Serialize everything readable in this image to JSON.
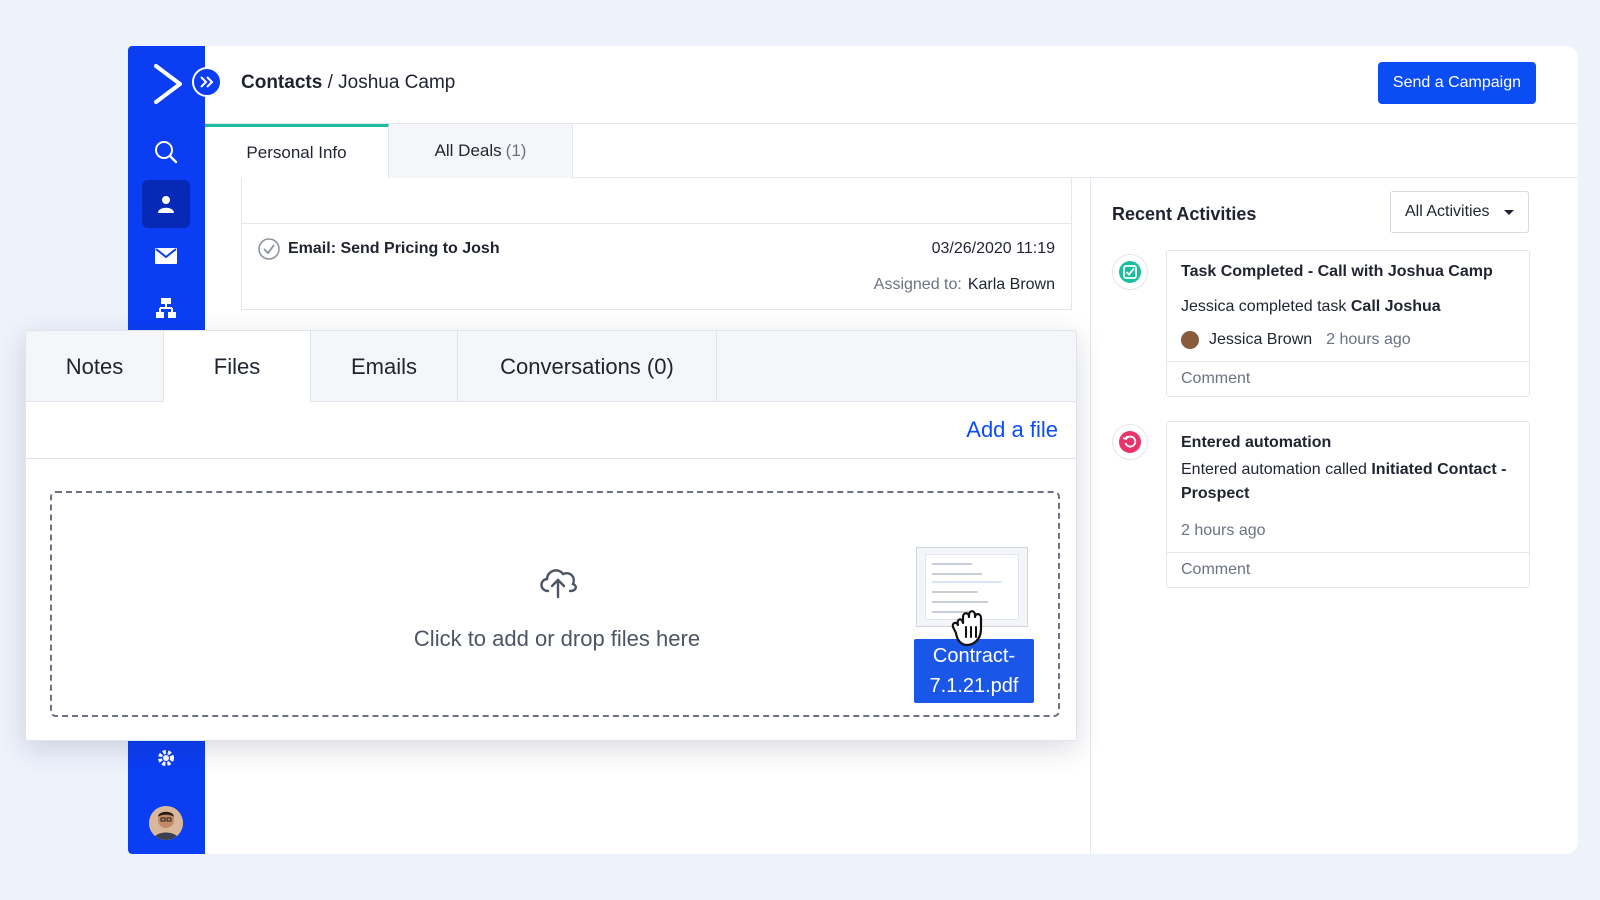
{
  "header": {
    "breadcrumb_root": "Contacts",
    "breadcrumb_sep": "/",
    "breadcrumb_current": "Joshua Camp",
    "send_campaign": "Send a Campaign"
  },
  "sidebar": {
    "items": [
      {
        "name": "search-icon"
      },
      {
        "name": "contacts-icon",
        "active": true
      },
      {
        "name": "email-icon"
      },
      {
        "name": "automation-icon"
      },
      {
        "name": "settings-icon"
      }
    ]
  },
  "top_tabs": [
    {
      "label": "Personal Info",
      "active": true
    },
    {
      "label": "All Deals",
      "count": "(1)"
    }
  ],
  "task": {
    "title": "Email: Send Pricing to Josh",
    "date": "03/26/2020 11:19",
    "assigned_label": "Assigned to:",
    "assigned_to": "Karla Brown"
  },
  "file_tabs": [
    {
      "label": "Notes"
    },
    {
      "label": "Files",
      "active": true
    },
    {
      "label": "Emails"
    },
    {
      "label": "Conversations (0)"
    }
  ],
  "files": {
    "add_file": "Add a file",
    "drop_text": "Click to add or drop files here",
    "dragged_file": "Contract-7.1.21.pdf"
  },
  "recent": {
    "title": "Recent Activities",
    "filter": "All Activities",
    "items": [
      {
        "head": "Task Completed - Call with Joshua Camp",
        "text_prefix": "Jessica completed task ",
        "text_bold": "Call Joshua",
        "user": "Jessica Brown",
        "time": "2 hours ago",
        "comment": "Comment",
        "icon_color": "#1bbf9d"
      },
      {
        "head": "Entered automation",
        "text_prefix": "Entered automation called ",
        "text_bold": "Initiated Contact - Prospect",
        "time": "2 hours ago",
        "comment": "Comment",
        "icon_color": "#e8336b"
      }
    ]
  },
  "colors": {
    "brand": "#0b3df2",
    "accent": "#0b4df5",
    "tab_indicator": "#1bbf9d"
  }
}
